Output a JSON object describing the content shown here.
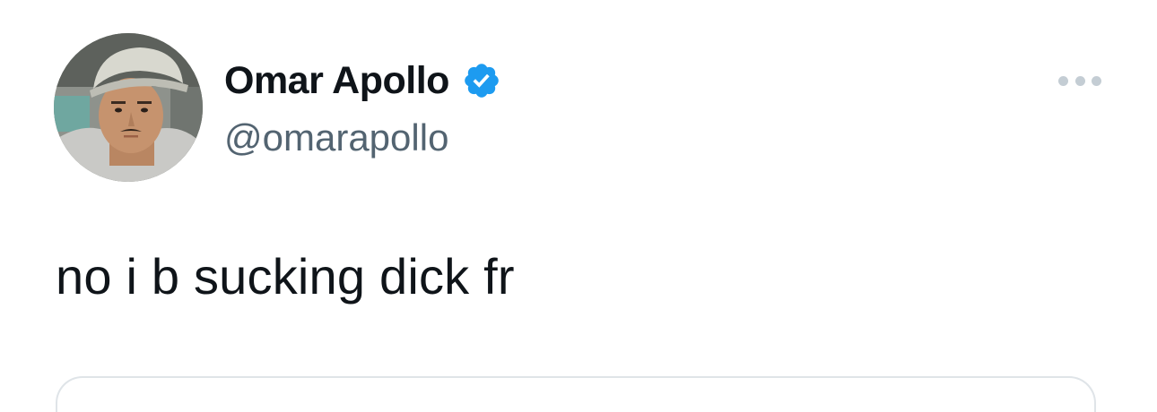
{
  "tweet": {
    "author": {
      "display_name": "Omar Apollo",
      "handle": "@omarapollo",
      "verified": true,
      "verified_icon": "verified-badge-icon",
      "avatar_icon": "profile-photo"
    },
    "text": "no i b sucking dick fr",
    "more_icon": "more-options-icon"
  },
  "colors": {
    "text_primary": "#0f1419",
    "text_secondary": "#536471",
    "verified_blue": "#1d9bf0",
    "more_dots": "#c4cdd4",
    "border": "#dfe4e8",
    "background": "#ffffff"
  }
}
